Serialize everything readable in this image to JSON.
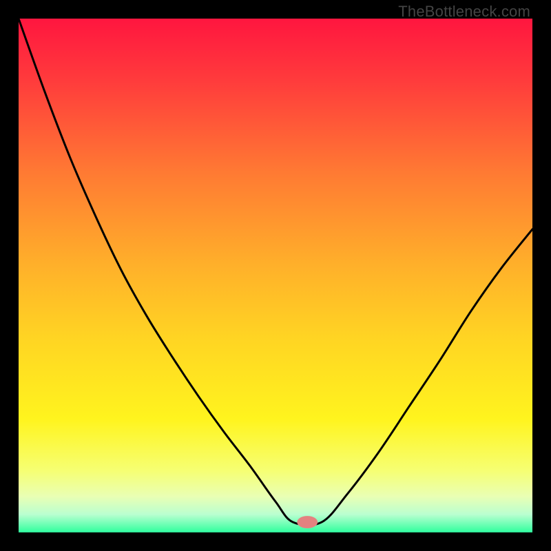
{
  "watermark": "TheBottleneck.com",
  "chart_data": {
    "type": "line",
    "title": "",
    "xlabel": "",
    "ylabel": "",
    "xlim": [
      0,
      1
    ],
    "ylim": [
      0,
      1
    ],
    "gradient_stops": [
      {
        "offset": 0.0,
        "color": "#ff163f"
      },
      {
        "offset": 0.12,
        "color": "#ff3b3c"
      },
      {
        "offset": 0.3,
        "color": "#ff7a33"
      },
      {
        "offset": 0.48,
        "color": "#ffb02a"
      },
      {
        "offset": 0.62,
        "color": "#ffd423"
      },
      {
        "offset": 0.78,
        "color": "#fff41e"
      },
      {
        "offset": 0.88,
        "color": "#f6ff73"
      },
      {
        "offset": 0.93,
        "color": "#e9ffb4"
      },
      {
        "offset": 0.965,
        "color": "#baffd0"
      },
      {
        "offset": 1.0,
        "color": "#2fff9e"
      }
    ],
    "series": [
      {
        "name": "left-curve",
        "x": [
          0.0,
          0.05,
          0.1,
          0.15,
          0.2,
          0.25,
          0.3,
          0.35,
          0.4,
          0.45,
          0.5,
          0.534
        ],
        "y": [
          1.0,
          0.86,
          0.73,
          0.615,
          0.51,
          0.42,
          0.34,
          0.265,
          0.195,
          0.13,
          0.06,
          0.02
        ]
      },
      {
        "name": "flat-bottom",
        "x": [
          0.534,
          0.59
        ],
        "y": [
          0.02,
          0.02
        ]
      },
      {
        "name": "right-curve",
        "x": [
          0.59,
          0.64,
          0.7,
          0.76,
          0.82,
          0.88,
          0.94,
          1.0
        ],
        "y": [
          0.02,
          0.075,
          0.155,
          0.245,
          0.335,
          0.43,
          0.515,
          0.59
        ]
      }
    ],
    "marker": {
      "name": "bottom-marker",
      "x": 0.562,
      "y": 0.02,
      "rx": 0.02,
      "ry": 0.012,
      "color": "#e48280"
    }
  }
}
